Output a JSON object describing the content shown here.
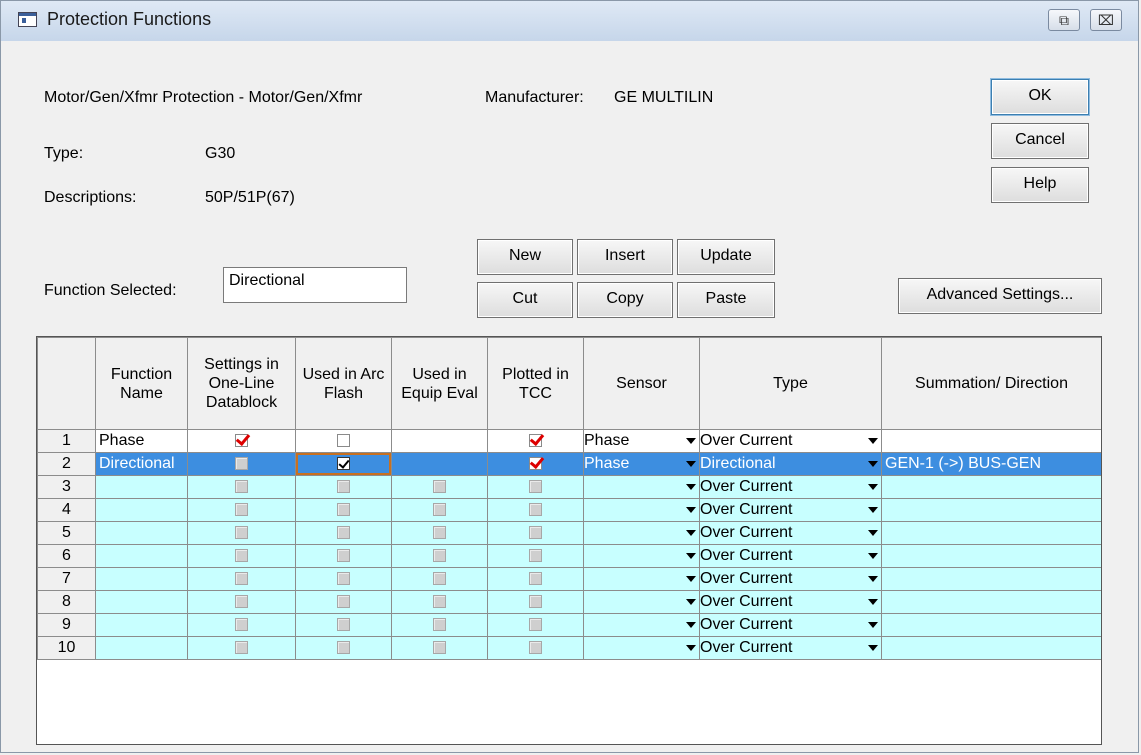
{
  "window": {
    "title": "Protection Functions"
  },
  "titlebar_buttons": {
    "restore": "⧉",
    "close": "⌧"
  },
  "info": {
    "device": "Motor/Gen/Xfmr Protection - Motor/Gen/Xfmr",
    "manufacturer_label": "Manufacturer:",
    "manufacturer_value": "GE MULTILIN",
    "type_label": "Type:",
    "type_value": "G30",
    "desc_label": "Descriptions:",
    "desc_value": "50P/51P(67)",
    "function_selected_label": "Function Selected:",
    "function_selected_value": "Directional"
  },
  "buttons": {
    "ok": "OK",
    "cancel": "Cancel",
    "help": "Help",
    "new": "New",
    "insert": "Insert",
    "update": "Update",
    "cut": "Cut",
    "copy": "Copy",
    "paste": "Paste",
    "advanced": "Advanced Settings..."
  },
  "grid": {
    "headers": {
      "function_name": "Function Name",
      "settings": "Settings in One-Line Datablock",
      "arc_flash": "Used in Arc Flash",
      "equip_eval": "Used in Equip Eval",
      "tcc": "Plotted in TCC",
      "sensor": "Sensor",
      "type": "Type",
      "summation": "Summation/ Direction"
    },
    "rows": [
      {
        "num": "1",
        "name": "Phase",
        "settings": "red",
        "arc": "empty",
        "equip": "none",
        "tcc": "red",
        "sensor": "Phase",
        "type": "Over Current",
        "sum": ""
      },
      {
        "num": "2",
        "name": "Directional",
        "settings": "disabled",
        "arc": "black",
        "equip": "none",
        "tcc": "red",
        "sensor": "Phase",
        "type": "Directional",
        "sum": "GEN-1 (->) BUS-GEN"
      },
      {
        "num": "3",
        "name": "",
        "settings": "disabled",
        "arc": "disabled",
        "equip": "disabled",
        "tcc": "disabled",
        "sensor": "",
        "type": "Over Current",
        "sum": ""
      },
      {
        "num": "4",
        "name": "",
        "settings": "disabled",
        "arc": "disabled",
        "equip": "disabled",
        "tcc": "disabled",
        "sensor": "",
        "type": "Over Current",
        "sum": ""
      },
      {
        "num": "5",
        "name": "",
        "settings": "disabled",
        "arc": "disabled",
        "equip": "disabled",
        "tcc": "disabled",
        "sensor": "",
        "type": "Over Current",
        "sum": ""
      },
      {
        "num": "6",
        "name": "",
        "settings": "disabled",
        "arc": "disabled",
        "equip": "disabled",
        "tcc": "disabled",
        "sensor": "",
        "type": "Over Current",
        "sum": ""
      },
      {
        "num": "7",
        "name": "",
        "settings": "disabled",
        "arc": "disabled",
        "equip": "disabled",
        "tcc": "disabled",
        "sensor": "",
        "type": "Over Current",
        "sum": ""
      },
      {
        "num": "8",
        "name": "",
        "settings": "disabled",
        "arc": "disabled",
        "equip": "disabled",
        "tcc": "disabled",
        "sensor": "",
        "type": "Over Current",
        "sum": ""
      },
      {
        "num": "9",
        "name": "",
        "settings": "disabled",
        "arc": "disabled",
        "equip": "disabled",
        "tcc": "disabled",
        "sensor": "",
        "type": "Over Current",
        "sum": ""
      },
      {
        "num": "10",
        "name": "",
        "settings": "disabled",
        "arc": "disabled",
        "equip": "disabled",
        "tcc": "disabled",
        "sensor": "",
        "type": "Over Current",
        "sum": ""
      }
    ]
  }
}
